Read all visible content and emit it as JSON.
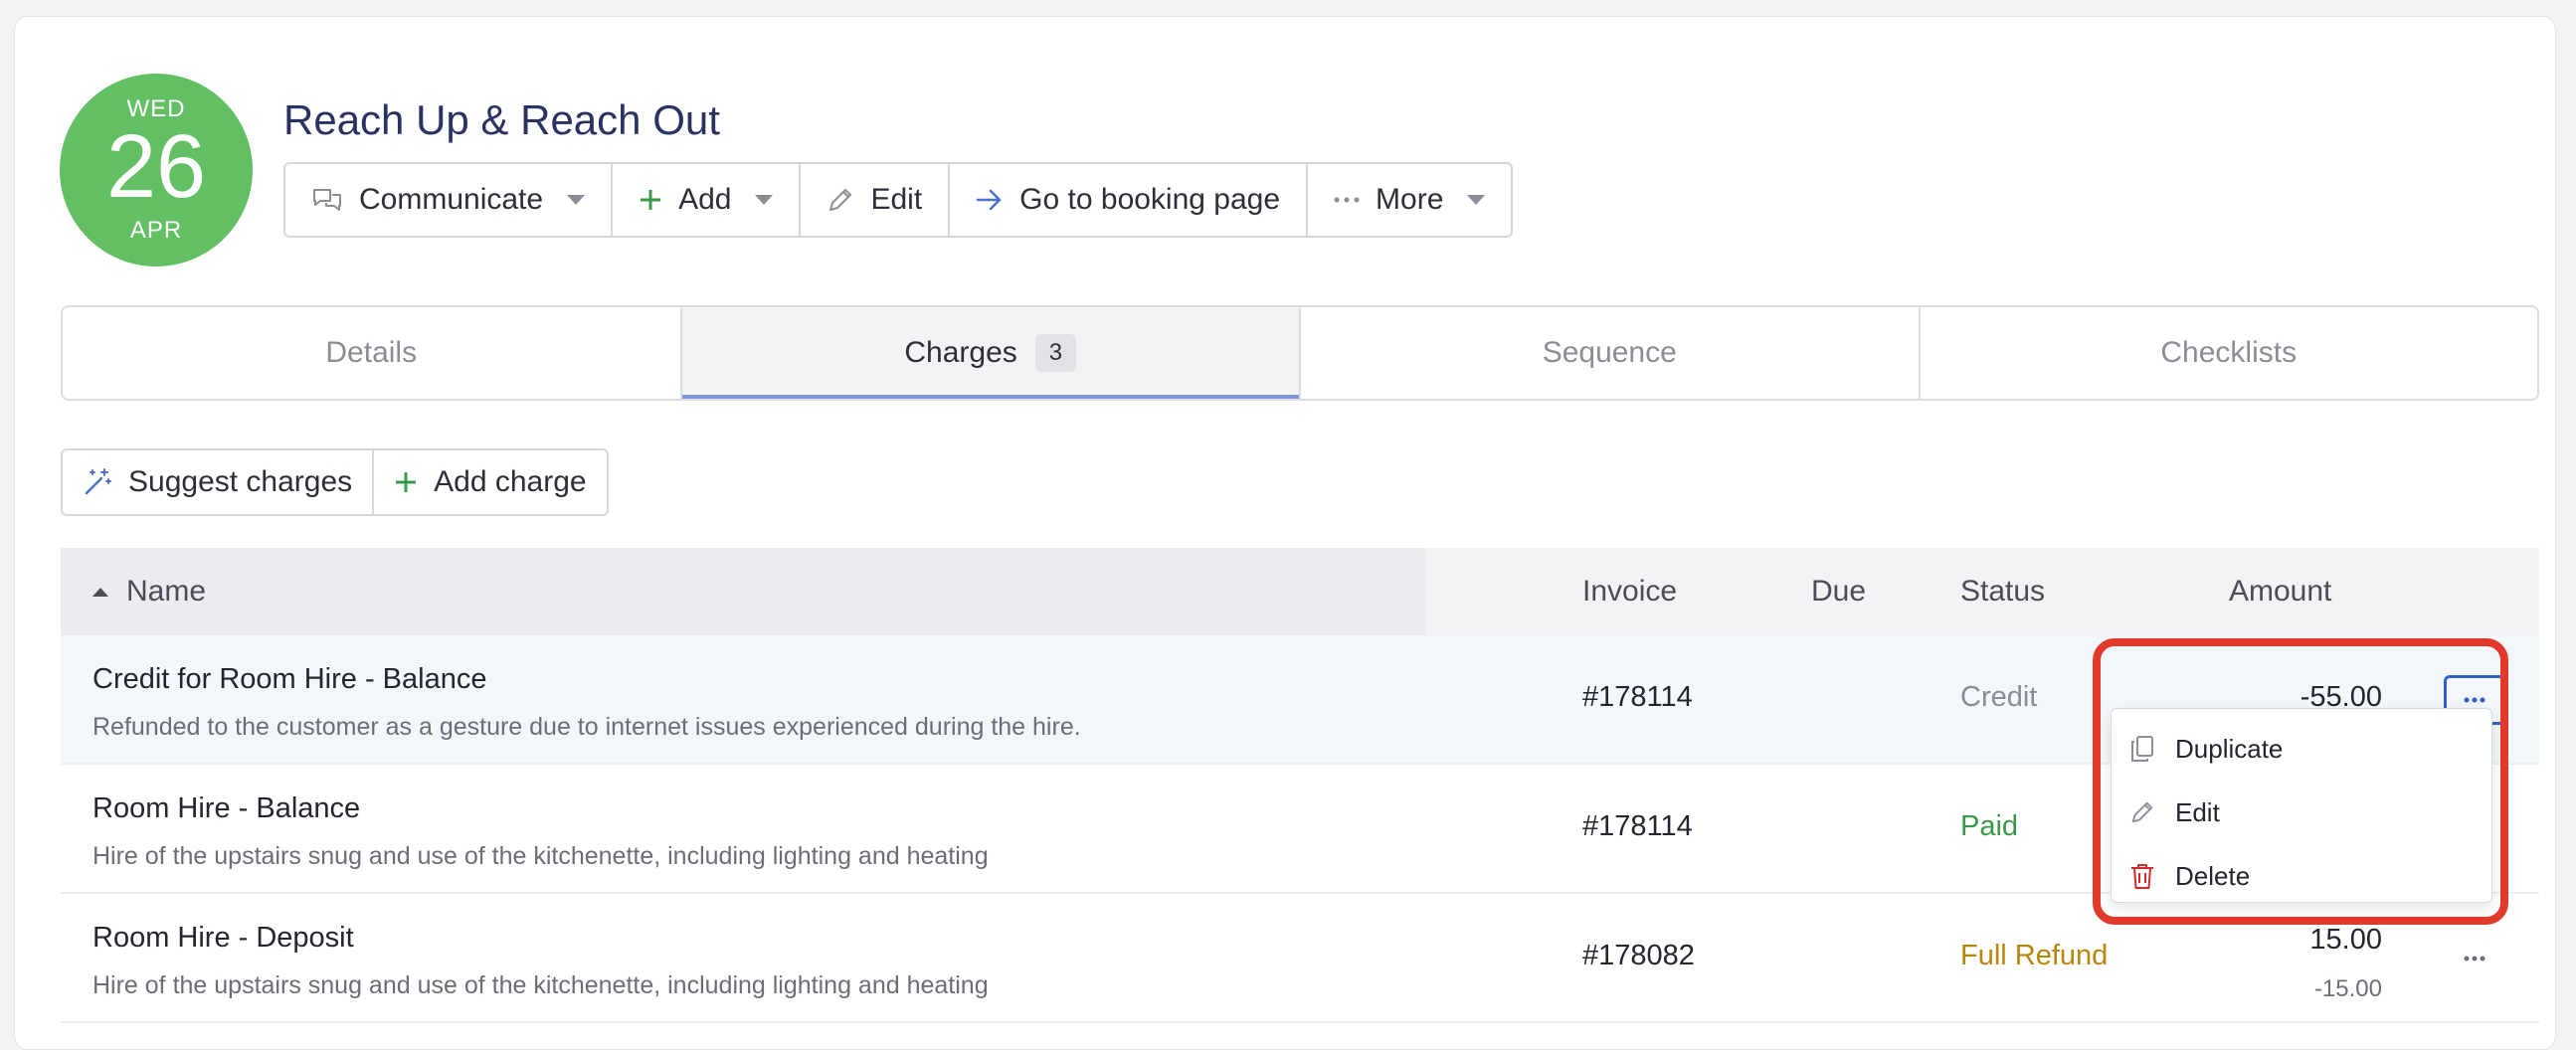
{
  "date_badge": {
    "weekday": "WED",
    "day": "26",
    "month": "APR",
    "color": "#63bf63"
  },
  "event": {
    "title": "Reach Up & Reach Out"
  },
  "toolbar": {
    "communicate": "Communicate",
    "add": "Add",
    "edit": "Edit",
    "booking": "Go to booking page",
    "more": "More"
  },
  "tabs": [
    {
      "label": "Details"
    },
    {
      "label": "Charges",
      "count": "3"
    },
    {
      "label": "Sequence"
    },
    {
      "label": "Checklists"
    }
  ],
  "charge_actions": {
    "suggest": "Suggest charges",
    "add": "Add charge"
  },
  "table": {
    "headers": {
      "name": "Name",
      "invoice": "Invoice",
      "due": "Due",
      "status": "Status",
      "amount": "Amount"
    },
    "rows": [
      {
        "name": "Credit for Room Hire - Balance",
        "description": "Refunded to the customer as a gesture due to internet issues experienced during the hire.",
        "invoice": "#178114",
        "status": "Credit",
        "amount": "-55.00"
      },
      {
        "name": "Room Hire - Balance",
        "description": "Hire of the upstairs snug and use of the kitchenette, including lighting and heating",
        "invoice": "#178114",
        "status": "Paid"
      },
      {
        "name": "Room Hire - Deposit",
        "description": "Hire of the upstairs snug and use of the kitchenette, including lighting and heating",
        "invoice": "#178082",
        "status": "Full Refund",
        "amount": "15.00",
        "amount_secondary": "-15.00"
      }
    ]
  },
  "row_menu": {
    "duplicate": "Duplicate",
    "edit": "Edit",
    "delete": "Delete"
  },
  "colors": {
    "accent": "#2f62c9",
    "status_credit": "#8a8d96",
    "status_paid": "#3a9a4a",
    "status_refund": "#b8860b",
    "delete": "#d22b2b",
    "highlight": "#e23a2a"
  }
}
